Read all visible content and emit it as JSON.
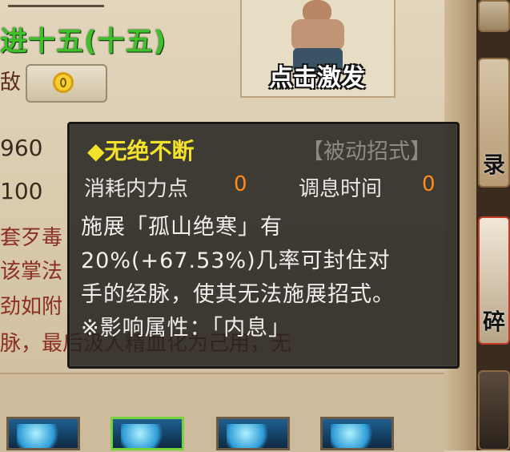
{
  "header": {
    "level_title": "进十五(十五)",
    "row_label": "敌",
    "coin_icon": "gold-coin-icon"
  },
  "portrait": {
    "activate_label": "点击激发"
  },
  "stats": {
    "value_a": "960",
    "value_b": "100"
  },
  "background_text": [
    "套歹毒",
    "该掌法",
    "劲如附",
    "脉，最后汲人精血化为己用，无"
  ],
  "right_strip": {
    "slot2_glyph": "录",
    "slot3_glyph": "碎"
  },
  "tooltip": {
    "skill_name": "◆无绝不断",
    "skill_type": "【被动招式】",
    "cost_label": "消耗内力点",
    "cost_value": "0",
    "cooldown_label": "调息时间",
    "cooldown_value": "0",
    "desc_lines": [
      "施展「孤山绝寒」有",
      "20%(+67.53%)几率可封住对",
      "手的经脉，使其无法施展招式。",
      "※影响属性：「内息」"
    ]
  },
  "colors": {
    "tooltip_title": "#f3e12c",
    "tooltip_value": "#ff8a1d",
    "level_green": "#3fbf2a",
    "desc_red": "#8a2f22"
  }
}
